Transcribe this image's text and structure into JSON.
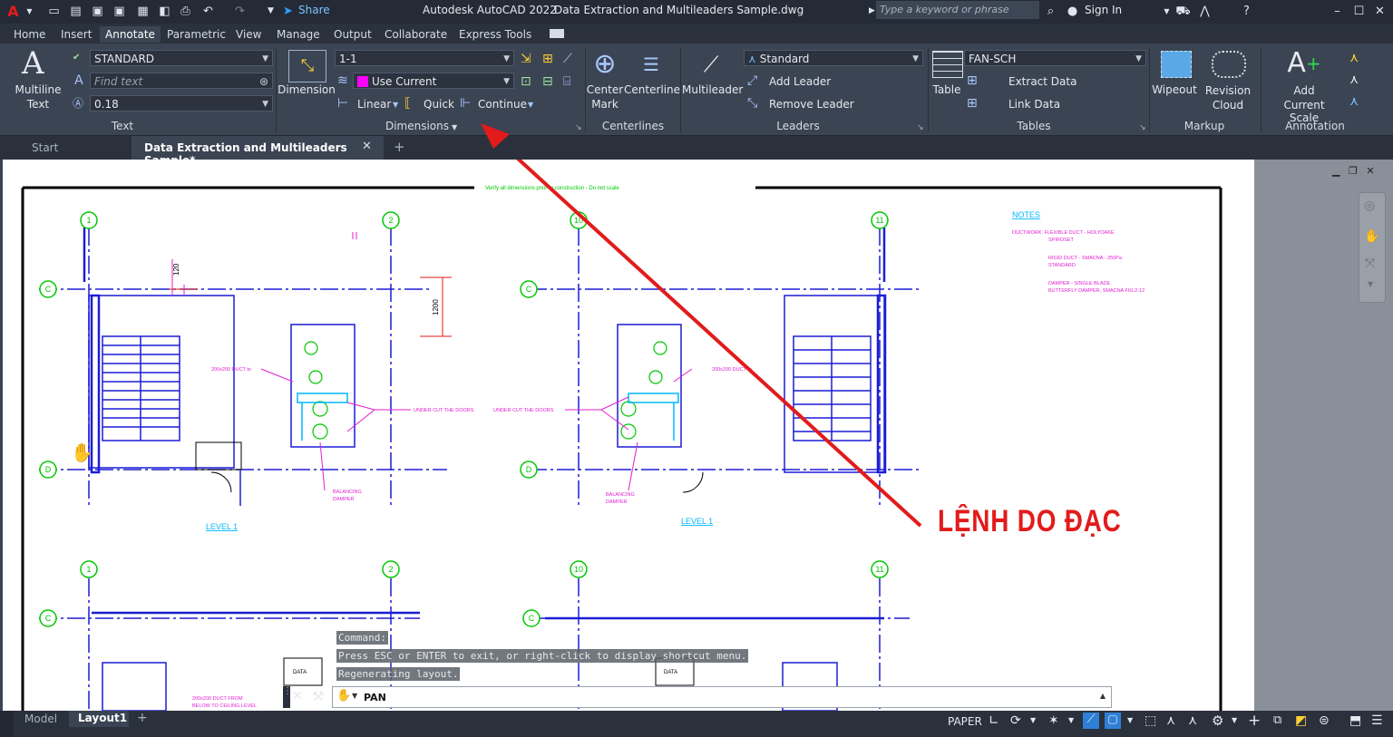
{
  "app": {
    "title": "Autodesk AutoCAD 2022",
    "document": "Data Extraction and Multileaders Sample.dwg",
    "share_label": "Share",
    "search_placeholder": "Type a keyword or phrase",
    "sign_in": "Sign In"
  },
  "ribbon_tabs": [
    "Home",
    "Insert",
    "Annotate",
    "Parametric",
    "View",
    "Manage",
    "Output",
    "Collaborate",
    "Express Tools"
  ],
  "ribbon": {
    "text_panel": {
      "title": "Text",
      "big_label_1": "Multiline",
      "big_label_2": "Text",
      "style": "STANDARD",
      "find_placeholder": "Find text",
      "height": "0.18"
    },
    "dim_panel": {
      "title": "Dimensions",
      "big_label": "Dimension",
      "dim_style": "1-1",
      "layer": "Use Current",
      "linear": "Linear",
      "quick": "Quick",
      "continue": "Continue"
    },
    "centerlines_panel": {
      "title": "Centerlines",
      "center_mark_1": "Center",
      "center_mark_2": "Mark",
      "centerline": "Centerline"
    },
    "leaders_panel": {
      "title": "Leaders",
      "big_label": "Multileader",
      "style": "Standard",
      "add_leader": "Add Leader",
      "remove_leader": "Remove Leader"
    },
    "tables_panel": {
      "title": "Tables",
      "big_label": "Table",
      "style": "FAN-SCH",
      "extract": "Extract Data",
      "link": "Link Data"
    },
    "markup_panel": {
      "title": "Markup",
      "wipeout": "Wipeout",
      "revision_1": "Revision",
      "revision_2": "Cloud"
    },
    "scaling_panel": {
      "title": "Annotation Scaling",
      "add_1": "Add",
      "add_2": "Current Scale"
    }
  },
  "doc_tabs": {
    "start": "Start",
    "active": "Data Extraction and Multileaders Sample*"
  },
  "drawing": {
    "top_note": "Verify all dimensions prior to construction - Do not scale",
    "notes_title": "NOTES",
    "notes": [
      "DUCTWORK:  FLEXIBLE DUCT - HOLYOAKE",
      "SPIROSET",
      "RIGID DUCT - SMACNA - 250Pa",
      "STANDARD",
      "DAMPER - SINGLE BLADE",
      "BUTTERFLY DAMPER, SMACNA FIG.2-12"
    ],
    "grid_labels": [
      "1",
      "2",
      "10",
      "11",
      "C",
      "D"
    ],
    "level_label": "LEVEL 1",
    "duct_label": "200x200 DUCT to",
    "undercut": "UNDER CUT THE DOORS",
    "balancing_1": "BALANCING",
    "balancing_2": "DAMPER",
    "dim_120": "120",
    "dim_1200": "1200",
    "data_label": "DATA",
    "duct_from_1": "200x200 DUCT FROM",
    "duct_from_2": "BELOW TO CEILING LEVEL"
  },
  "command": {
    "history": [
      "Command:",
      "Press ESC or ENTER to exit, or right-click to display shortcut menu.",
      "Regenerating layout."
    ],
    "current": "PAN"
  },
  "callout": "LỆNH DO ĐẠC",
  "status": {
    "model": "Model",
    "layout": "Layout1",
    "paper": "PAPER"
  },
  "colors": {
    "accent_red": "#e21b1b",
    "drawing_blue": "#1c1cd6",
    "magenta": "#e01fd1",
    "green": "#00c800",
    "cyan": "#00b7ff"
  }
}
